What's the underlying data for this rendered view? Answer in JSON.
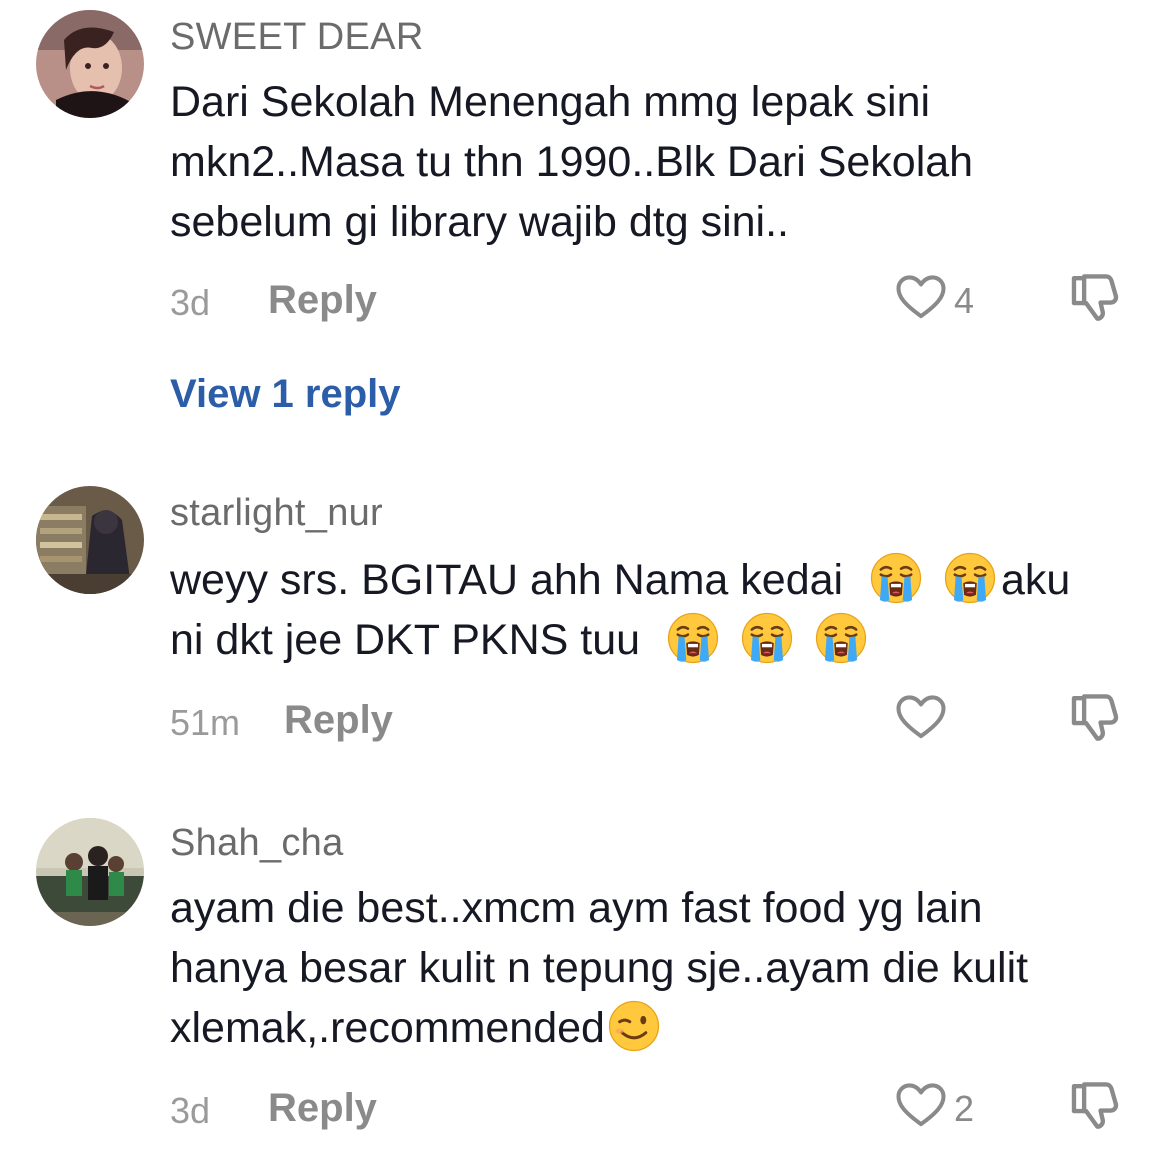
{
  "comments": [
    {
      "username": "SWEET DEAR",
      "text_lines": [
        "Dari Sekolah Menengah mmg lepak sini",
        "mkn2..Masa tu thn 1990..Blk Dari Sekolah",
        "sebelum gi library wajib dtg sini.."
      ],
      "time": "3d",
      "reply_label": "Reply",
      "like_count": "4",
      "view_replies_label": "View 1 reply"
    },
    {
      "username": "starlight_nur",
      "text_line1": "weyy srs. BGITAU ahh Nama kedai",
      "text_line1_end": "aku",
      "text_line2": "ni dkt jee DKT PKNS tuu",
      "time": "51m",
      "reply_label": "Reply"
    },
    {
      "username": "Shah_cha",
      "text_lines": [
        "ayam die best..xmcm aym fast food yg lain",
        "hanya besar kulit n tepung sje..ayam die kulit"
      ],
      "text_line3": "xlemak,.recommended",
      "time": "3d",
      "reply_label": "Reply",
      "like_count": "2"
    }
  ],
  "icons": {
    "like": "heart-outline-icon",
    "dislike": "thumbs-down-outline-icon",
    "emoji_crying": "loudly-crying-face-emoji",
    "emoji_wink": "winking-face-emoji"
  },
  "colors": {
    "username": "#6b6b6b",
    "text": "#161823",
    "meta": "#9a9a9a",
    "link": "#2b5da8",
    "icon": "#8a8a8a"
  }
}
